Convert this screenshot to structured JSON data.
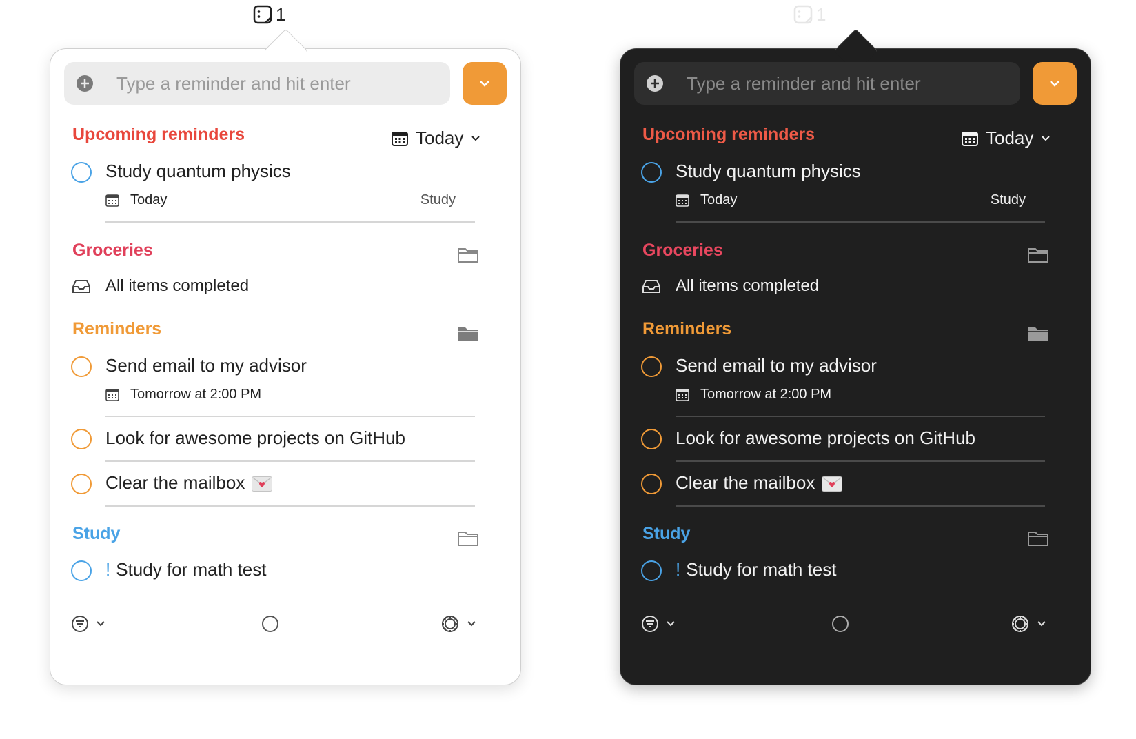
{
  "menubar": {
    "badge_count": "1"
  },
  "input": {
    "placeholder": "Type a reminder and hit enter"
  },
  "upcoming": {
    "title": "Upcoming reminders",
    "filter_label": "Today",
    "items": [
      {
        "title": "Study quantum physics",
        "date": "Today",
        "list": "Study"
      }
    ]
  },
  "groceries": {
    "title": "Groceries",
    "empty_text": "All items completed"
  },
  "reminders": {
    "title": "Reminders",
    "items": [
      {
        "title": "Send email to my advisor",
        "date": "Tomorrow at 2:00 PM"
      },
      {
        "title": "Look for awesome projects on GitHub"
      },
      {
        "title": "Clear the mailbox"
      }
    ]
  },
  "study": {
    "title": "Study",
    "items": [
      {
        "priority": "!",
        "title": "Study for math test"
      }
    ]
  },
  "colors": {
    "accent_orange": "#f09a37",
    "upcoming_red": "#e8473c",
    "groceries_red": "#e0405a",
    "reminders_orange": "#f09a37",
    "study_blue": "#4aa3e6"
  }
}
